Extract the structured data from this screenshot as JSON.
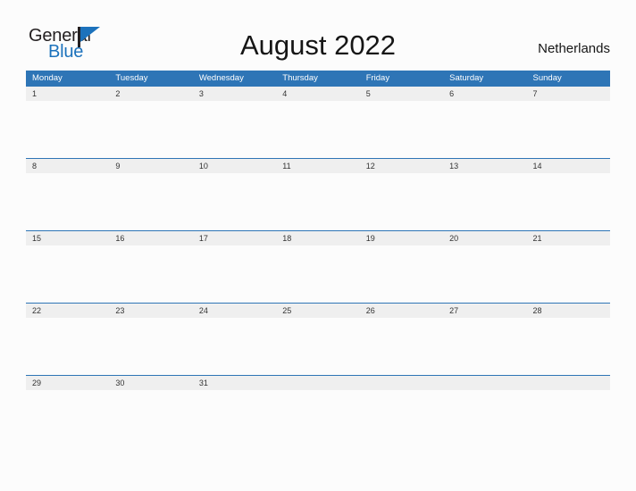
{
  "header": {
    "logo": {
      "primary_text": "General",
      "secondary_text": "Blue",
      "primary_color": "#231f20",
      "secondary_color": "#1c72bc"
    },
    "title": "August 2022",
    "country": "Netherlands"
  },
  "theme": {
    "header_blue": "#2e75b6",
    "band_gray": "#efefef",
    "page_background": "#fcfcfc",
    "header_text": "#ffffff",
    "date_text": "#333333"
  },
  "calendar": {
    "month": "August",
    "year": "2022",
    "weekday_headers": [
      "Monday",
      "Tuesday",
      "Wednesday",
      "Thursday",
      "Friday",
      "Saturday",
      "Sunday"
    ],
    "weeks": [
      {
        "days": [
          {
            "date": "1"
          },
          {
            "date": "2"
          },
          {
            "date": "3"
          },
          {
            "date": "4"
          },
          {
            "date": "5"
          },
          {
            "date": "6"
          },
          {
            "date": "7"
          }
        ]
      },
      {
        "days": [
          {
            "date": "8"
          },
          {
            "date": "9"
          },
          {
            "date": "10"
          },
          {
            "date": "11"
          },
          {
            "date": "12"
          },
          {
            "date": "13"
          },
          {
            "date": "14"
          }
        ]
      },
      {
        "days": [
          {
            "date": "15"
          },
          {
            "date": "16"
          },
          {
            "date": "17"
          },
          {
            "date": "18"
          },
          {
            "date": "19"
          },
          {
            "date": "20"
          },
          {
            "date": "21"
          }
        ]
      },
      {
        "days": [
          {
            "date": "22"
          },
          {
            "date": "23"
          },
          {
            "date": "24"
          },
          {
            "date": "25"
          },
          {
            "date": "26"
          },
          {
            "date": "27"
          },
          {
            "date": "28"
          }
        ]
      },
      {
        "days": [
          {
            "date": "29"
          },
          {
            "date": "30"
          },
          {
            "date": "31"
          },
          {
            "date": ""
          },
          {
            "date": ""
          },
          {
            "date": ""
          },
          {
            "date": ""
          }
        ]
      }
    ]
  }
}
